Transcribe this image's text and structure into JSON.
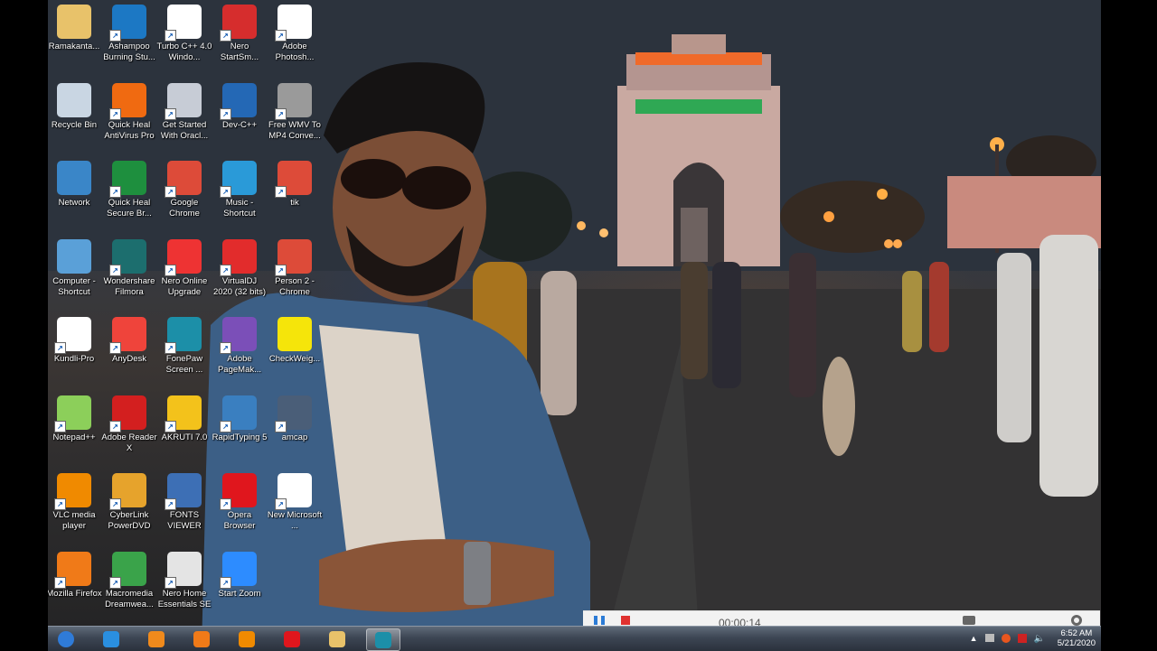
{
  "desktop": {
    "icons": [
      {
        "label": "Ramakanta...",
        "icon": "folder-user-icon",
        "color": "#e8c26a"
      },
      {
        "label": "Ashampoo Burning Stu...",
        "icon": "ashampoo-flame-icon",
        "color": "#1c78c4"
      },
      {
        "label": "Turbo C++ 4.0 Windo...",
        "icon": "turbo-cpp-icon",
        "color": "#ffffff"
      },
      {
        "label": "Nero StartSm...",
        "icon": "nero-icon",
        "color": "#d62d2d"
      },
      {
        "label": "Adobe Photosh...",
        "icon": "photoshop-feather-icon",
        "color": "#ffffff"
      },
      {
        "label": "Recycle Bin",
        "icon": "recycle-bin-icon",
        "color": "#c9d6e3"
      },
      {
        "label": "Quick Heal AntiVirus Pro",
        "icon": "quickheal-icon",
        "color": "#f06a11"
      },
      {
        "label": "Get Started With Oracl...",
        "icon": "oracle-database-icon",
        "color": "#c7ccd6"
      },
      {
        "label": "Dev-C++",
        "icon": "dev-cpp-icon",
        "color": "#2468b5"
      },
      {
        "label": "Free WMV To MP4 Conve...",
        "icon": "film-reel-icon",
        "color": "#9a9a9a"
      },
      {
        "label": "Network",
        "icon": "network-globe-icon",
        "color": "#3a86c8"
      },
      {
        "label": "Quick Heal Secure Br...",
        "icon": "quickheal-browser-icon",
        "color": "#1e8f3e"
      },
      {
        "label": "Google Chrome",
        "icon": "chrome-icon",
        "color": "#dd4b39"
      },
      {
        "label": "Music - Shortcut",
        "icon": "music-note-icon",
        "color": "#2a9ad8"
      },
      {
        "label": "tik",
        "icon": "chrome-profile-icon",
        "color": "#dd4b39"
      },
      {
        "label": "Computer - Shortcut",
        "icon": "computer-icon",
        "color": "#5aa0d8"
      },
      {
        "label": "Wondershare Filmora",
        "icon": "filmora-icon",
        "color": "#1c6e6e"
      },
      {
        "label": "Nero Online Upgrade",
        "icon": "nero-upgrade-icon",
        "color": "#e33"
      },
      {
        "label": "VirtualDJ 2020 (32 bits)",
        "icon": "virtualdj-icon",
        "color": "#e22c2c"
      },
      {
        "label": "Person 2 - Chrome",
        "icon": "chrome-profile-icon",
        "color": "#dd4b39"
      },
      {
        "label": "Kundli-Pro",
        "icon": "kundli-grid-icon",
        "color": "#ffffff"
      },
      {
        "label": "AnyDesk",
        "icon": "anydesk-icon",
        "color": "#ef443b"
      },
      {
        "label": "FonePaw Screen ...",
        "icon": "fonepaw-camera-icon",
        "color": "#1c8fa8"
      },
      {
        "label": "Adobe PageMak...",
        "icon": "pagemaker-icon",
        "color": "#7b4fb8"
      },
      {
        "label": "CheckWeig...",
        "icon": "smiley-icon",
        "color": "#f5e50a"
      },
      {
        "label": "Notepad++",
        "icon": "notepadpp-icon",
        "color": "#8ccf5a"
      },
      {
        "label": "Adobe Reader X",
        "icon": "adobe-reader-icon",
        "color": "#d31f1f"
      },
      {
        "label": "AKRUTI 7.0",
        "icon": "akruti-icon",
        "color": "#f3c21b"
      },
      {
        "label": "RapidTyping 5",
        "icon": "rapidtyping-icon",
        "color": "#3a7fc0"
      },
      {
        "label": "amcap",
        "icon": "camera-icon",
        "color": "#4a5e78"
      },
      {
        "label": "VLC media player",
        "icon": "vlc-cone-icon",
        "color": "#f08a00"
      },
      {
        "label": "CyberLink PowerDVD",
        "icon": "powerdvd-icon",
        "color": "#e6a32c"
      },
      {
        "label": "FONTS VIEWER",
        "icon": "fonts-viewer-icon",
        "color": "#3d6fb5"
      },
      {
        "label": "Opera Browser",
        "icon": "opera-icon",
        "color": "#e0161d"
      },
      {
        "label": "New Microsoft ...",
        "icon": "document-icon",
        "color": "#ffffff"
      },
      {
        "label": "Mozilla Firefox",
        "icon": "firefox-icon",
        "color": "#f07a18"
      },
      {
        "label": "Macromedia Dreamwea...",
        "icon": "dreamweaver-icon",
        "color": "#3aa34a"
      },
      {
        "label": "Nero Home Essentials SE",
        "icon": "nero-home-icon",
        "color": "#e4e4e4"
      },
      {
        "label": "Start Zoom",
        "icon": "zoom-camera-icon",
        "color": "#2d8cff"
      }
    ]
  },
  "taskbar": {
    "buttons": [
      {
        "name": "start-button",
        "icon": "windows-orb-icon"
      },
      {
        "name": "internet-explorer-button",
        "icon": "ie-icon"
      },
      {
        "name": "media-player-button",
        "icon": "media-player-icon"
      },
      {
        "name": "firefox-button",
        "icon": "firefox-icon"
      },
      {
        "name": "vlc-button",
        "icon": "vlc-cone-icon"
      },
      {
        "name": "opera-button",
        "icon": "opera-icon"
      },
      {
        "name": "file-explorer-button",
        "icon": "folder-icon"
      },
      {
        "name": "fonepaw-button",
        "icon": "fonepaw-camera-icon"
      }
    ],
    "clock": {
      "time": "6:52 AM",
      "date": "5/21/2020"
    }
  },
  "recorder": {
    "timer": "00:00:14"
  }
}
